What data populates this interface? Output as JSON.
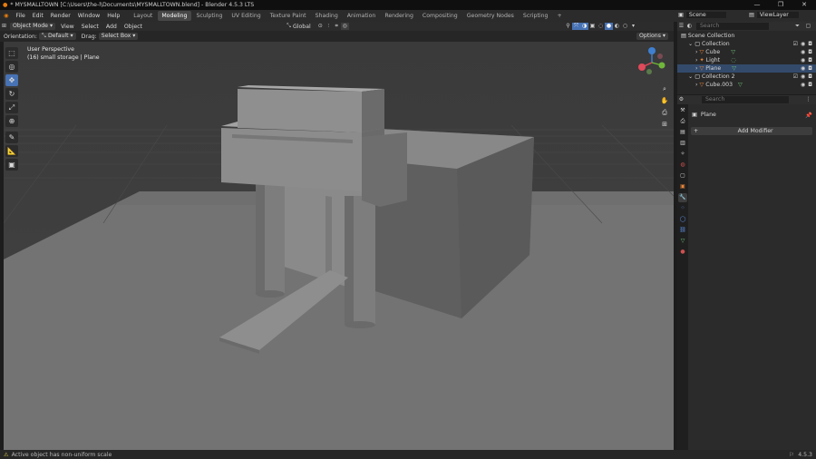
{
  "window": {
    "title": "* MYSMALLTOWN [C:\\Users\\the-l\\Documents\\MYSMALLTOWN.blend] - Blender 4.5.3 LTS",
    "minimize": "—",
    "maximize": "❐",
    "close": "✕"
  },
  "menus": [
    "File",
    "Edit",
    "Render",
    "Window",
    "Help"
  ],
  "workspaces": [
    "Layout",
    "Modeling",
    "Sculpting",
    "UV Editing",
    "Texture Paint",
    "Shading",
    "Animation",
    "Rendering",
    "Compositing",
    "Geometry Nodes",
    "Scripting"
  ],
  "active_workspace": "Modeling",
  "add_workspace": "+",
  "scene": {
    "name": "Scene",
    "view_layer": "ViewLayer"
  },
  "header": {
    "mode": "Object Mode",
    "view_menu": [
      "View",
      "Select",
      "Add",
      "Object"
    ],
    "transform_orientation": "Global"
  },
  "tool_settings": {
    "orientation_label": "Orientation:",
    "orientation_value": "Default",
    "drag_label": "Drag:",
    "drag_value": "Select Box",
    "options": "Options"
  },
  "viewport": {
    "line1": "User Perspective",
    "line2": "(16) small storage | Plane"
  },
  "outliner": {
    "search_placeholder": "Search",
    "root": "Scene Collection",
    "rows": [
      {
        "label": "Collection",
        "indent": 1,
        "type": "collection"
      },
      {
        "label": "Cube",
        "indent": 2,
        "type": "mesh"
      },
      {
        "label": "Light",
        "indent": 2,
        "type": "light"
      },
      {
        "label": "Plane",
        "indent": 2,
        "type": "mesh"
      },
      {
        "label": "Collection 2",
        "indent": 1,
        "type": "collection"
      },
      {
        "label": "Cube.003",
        "indent": 2,
        "type": "mesh"
      }
    ]
  },
  "properties": {
    "search_placeholder": "Search",
    "object_name": "Plane",
    "add_modifier": "Add Modifier"
  },
  "status": {
    "warning": "Active object has non-uniform scale",
    "version": "4.5.3"
  },
  "colors": {
    "accent": "#4772b3",
    "active_object": "#e7853a",
    "mesh_data": "#6fc27a"
  }
}
